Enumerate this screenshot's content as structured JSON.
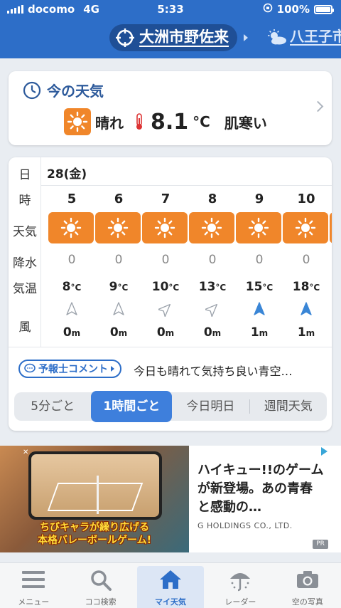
{
  "status_bar": {
    "carrier": "docomo",
    "network": "4G",
    "time": "5:33",
    "battery": "100%"
  },
  "header": {
    "current_location": "大洲市野佐来",
    "next_location": "八王子市"
  },
  "now": {
    "title": "今の天気",
    "condition": "晴れ",
    "temperature": "8.1",
    "unit": "°C",
    "feel": "肌寒い"
  },
  "forecast": {
    "labels": {
      "day": "日",
      "hour": "時",
      "weather": "天気",
      "rain": "降水",
      "temp": "気温",
      "wind": "風"
    },
    "date": "28(金)",
    "hours": [
      {
        "hour": "5",
        "weather_icon": "sun-icon",
        "rain": "0",
        "temp": "8",
        "temp_unit": "°C",
        "wind": "0",
        "wind_unit": "m",
        "wind_dir": "north-outline"
      },
      {
        "hour": "6",
        "weather_icon": "sun-icon",
        "rain": "0",
        "temp": "9",
        "temp_unit": "°C",
        "wind": "0",
        "wind_unit": "m",
        "wind_dir": "north-outline"
      },
      {
        "hour": "7",
        "weather_icon": "sun-icon",
        "rain": "0",
        "temp": "10",
        "temp_unit": "°C",
        "wind": "0",
        "wind_unit": "m",
        "wind_dir": "northeast-outline"
      },
      {
        "hour": "8",
        "weather_icon": "sun-icon",
        "rain": "0",
        "temp": "13",
        "temp_unit": "°C",
        "wind": "0",
        "wind_unit": "m",
        "wind_dir": "northeast-outline"
      },
      {
        "hour": "9",
        "weather_icon": "sun-icon",
        "rain": "0",
        "temp": "15",
        "temp_unit": "°C",
        "wind": "1",
        "wind_unit": "m",
        "wind_dir": "north-filled"
      },
      {
        "hour": "10",
        "weather_icon": "sun-icon",
        "rain": "0",
        "temp": "18",
        "temp_unit": "°C",
        "wind": "1",
        "wind_unit": "m",
        "wind_dir": "north-filled"
      }
    ],
    "comment_button": "予報士コメント",
    "comment_text": "今日も晴れて気持ち良い青空…",
    "tabs": [
      "5分ごと",
      "1時間ごと",
      "今日明日",
      "週間天気"
    ],
    "active_tab": "1時間ごと"
  },
  "ad": {
    "image_caption_line1": "ちびキャラが繰り広げる",
    "image_caption_line2": "本格バレーボールゲーム!",
    "title_line1": "ハイキュー!!のゲーム",
    "title_line2": "が新登場。あの青春",
    "title_line3": "と感動の…",
    "company": "G HOLDINGS CO., LTD.",
    "badge": "PR"
  },
  "tabbar": [
    {
      "label": "メニュー",
      "icon": "menu-icon"
    },
    {
      "label": "ココ検索",
      "icon": "search-icon"
    },
    {
      "label": "マイ天気",
      "icon": "home-icon"
    },
    {
      "label": "レーダー",
      "icon": "radar-umbrella-icon"
    },
    {
      "label": "空の写真",
      "icon": "camera-icon"
    }
  ],
  "colors": {
    "primary": "#2d6ec8",
    "sun_box": "#f0862a",
    "active_tab": "#3e7fdc"
  }
}
